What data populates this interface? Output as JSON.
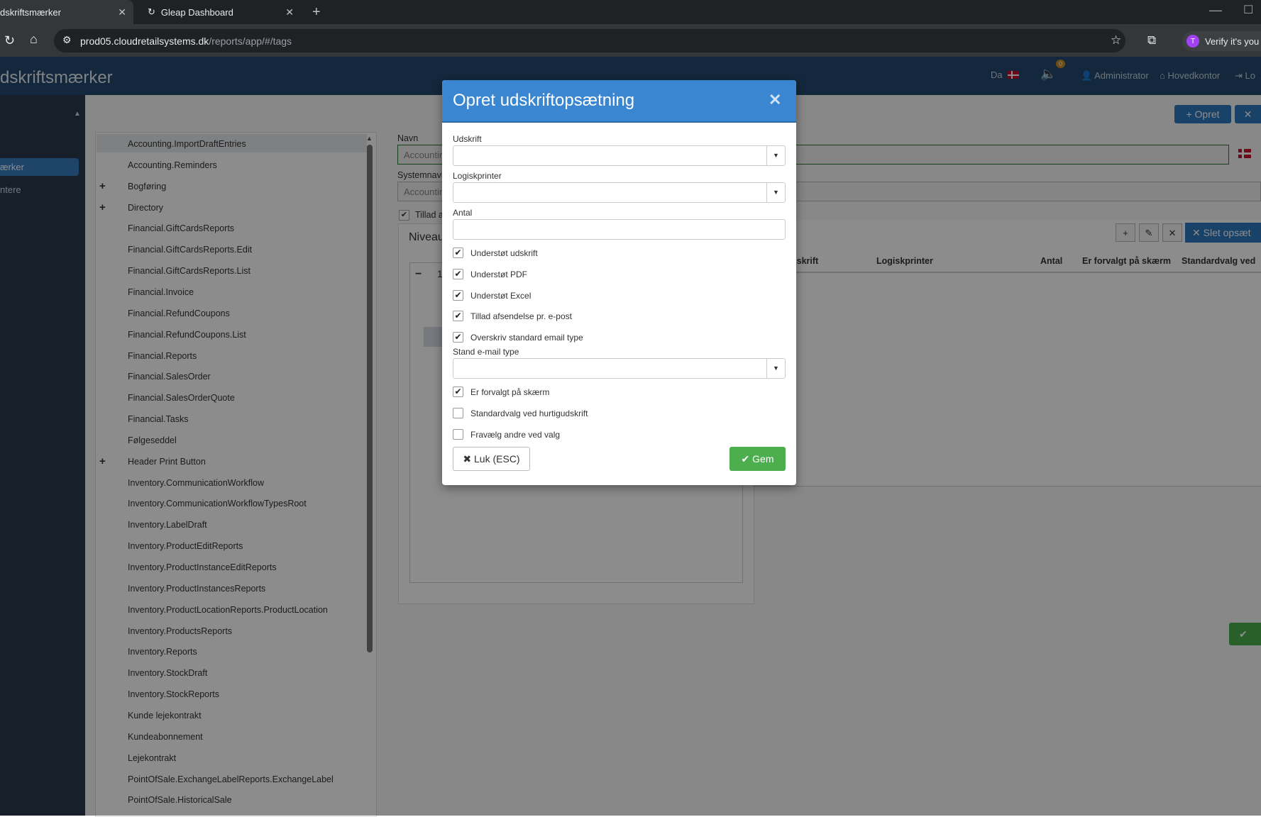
{
  "browser": {
    "tabs": [
      {
        "label": "dskriftsmærker",
        "active": true
      },
      {
        "label": "Gleap Dashboard",
        "active": false
      }
    ],
    "url_host": "prod05.cloudretailsystems.dk",
    "url_path": "/reports/app/#/tags",
    "profile_label": "Verify it's you",
    "profile_initial": "T",
    "accent": "#a142f4"
  },
  "app": {
    "title": "dskriftsmærker",
    "lang": "Da",
    "notification_count": "0",
    "user": "Administrator",
    "location": "Hovedkontor",
    "logout": "Lo",
    "brand_color": "#23496d"
  },
  "sidebar": {
    "items": [
      {
        "label": "ærker",
        "active": true
      },
      {
        "label": "ntere",
        "active": false
      }
    ]
  },
  "tree": {
    "items": [
      {
        "label": "Accounting.ImportDraftEntries",
        "expandable": false,
        "selected": true
      },
      {
        "label": "Accounting.Reminders",
        "expandable": false
      },
      {
        "label": "Bogføring",
        "expandable": true
      },
      {
        "label": "Directory",
        "expandable": true
      },
      {
        "label": "Financial.GiftCardsReports",
        "expandable": false
      },
      {
        "label": "Financial.GiftCardsReports.Edit",
        "expandable": false
      },
      {
        "label": "Financial.GiftCardsReports.List",
        "expandable": false
      },
      {
        "label": "Financial.Invoice",
        "expandable": false
      },
      {
        "label": "Financial.RefundCoupons",
        "expandable": false
      },
      {
        "label": "Financial.RefundCoupons.List",
        "expandable": false
      },
      {
        "label": "Financial.Reports",
        "expandable": false
      },
      {
        "label": "Financial.SalesOrder",
        "expandable": false
      },
      {
        "label": "Financial.SalesOrderQuote",
        "expandable": false
      },
      {
        "label": "Financial.Tasks",
        "expandable": false
      },
      {
        "label": "Følgeseddel",
        "expandable": false
      },
      {
        "label": "Header Print Button",
        "expandable": true
      },
      {
        "label": "Inventory.CommunicationWorkflow",
        "expandable": false
      },
      {
        "label": "Inventory.CommunicationWorkflowTypesRoot",
        "expandable": false
      },
      {
        "label": "Inventory.LabelDraft",
        "expandable": false
      },
      {
        "label": "Inventory.ProductEditReports",
        "expandable": false
      },
      {
        "label": "Inventory.ProductInstanceEditReports",
        "expandable": false
      },
      {
        "label": "Inventory.ProductInstancesReports",
        "expandable": false
      },
      {
        "label": "Inventory.ProductLocationReports.ProductLocation",
        "expandable": false
      },
      {
        "label": "Inventory.ProductsReports",
        "expandable": false
      },
      {
        "label": "Inventory.Reports",
        "expandable": false
      },
      {
        "label": "Inventory.StockDraft",
        "expandable": false
      },
      {
        "label": "Inventory.StockReports",
        "expandable": false
      },
      {
        "label": "Kunde lejekontrakt",
        "expandable": false
      },
      {
        "label": "Kundeabonnement",
        "expandable": false
      },
      {
        "label": "Lejekontrakt",
        "expandable": false
      },
      {
        "label": "PointOfSale.ExchangeLabelReports.ExchangeLabel",
        "expandable": false
      },
      {
        "label": "PointOfSale.HistoricalSale",
        "expandable": false
      }
    ]
  },
  "form": {
    "navn_label": "Navn",
    "navn_value": "Accountir",
    "system_label": "Systemnavn",
    "system_value": "Accountir",
    "tillad_label": "Tillad a",
    "niveau_title": "Niveau",
    "niveau_row_digit": "1",
    "opret_label": "Opret",
    "slet_label": "Slet opsæt",
    "columns": [
      "dskrift",
      "Logiskprinter",
      "Antal",
      "Er forvalgt på skærm",
      "Standardvalg ved"
    ]
  },
  "modal": {
    "title": "Opret udskriftopsætning",
    "udskrift_label": "Udskrift",
    "udskrift_value": "",
    "logiskprinter_label": "Logiskprinter",
    "logiskprinter_value": "",
    "antal_label": "Antal",
    "antal_value": "",
    "checkboxes": [
      {
        "label": "Understøt udskrift",
        "checked": true
      },
      {
        "label": "Understøt PDF",
        "checked": true
      },
      {
        "label": "Understøt Excel",
        "checked": true
      },
      {
        "label": "Tillad afsendelse pr. e-post",
        "checked": true
      },
      {
        "label": "Overskriv standard email type",
        "checked": true
      }
    ],
    "email_type_label": "Stand e-mail type",
    "email_type_value": "",
    "checkboxes2": [
      {
        "label": "Er forvalgt på skærm",
        "checked": true
      },
      {
        "label": "Standardvalg ved hurtigudskrift",
        "checked": false
      },
      {
        "label": "Fravælg andre ved valg",
        "checked": false
      }
    ],
    "close_label": "Luk (ESC)",
    "save_label": "Gem",
    "header_color": "#3a86d0",
    "save_color": "#4cae4c"
  }
}
